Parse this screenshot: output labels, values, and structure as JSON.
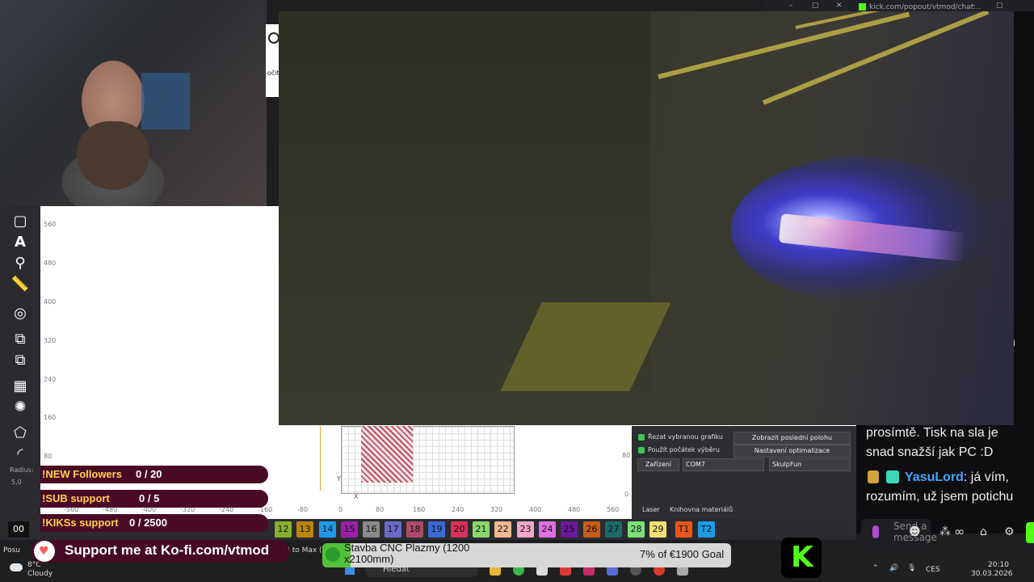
{
  "browser": {
    "url": "kick.com/popout/vtmod/chat..."
  },
  "app": {
    "y_ticks": [
      "560",
      "480",
      "400",
      "320",
      "240",
      "160",
      "80"
    ],
    "x_ticks": [
      "-560",
      "-480",
      "-400",
      "-320",
      "-240",
      "-160",
      "-80",
      "0",
      "80",
      "160",
      "240",
      "320",
      "400",
      "480",
      "560"
    ],
    "right_y": [
      "80",
      "0"
    ],
    "left_text": "očit",
    "radius_label": "Radius:",
    "radius_value": "5,0",
    "axis_y": "Y",
    "axis_x": "X",
    "panel": {
      "cut_selected": "Řezat vybranou grafiku",
      "use_selection_start": "Použít počátek výběru",
      "show_last_position": "Zobrazit poslední polohu",
      "optimization_settings": "Nastavení optimalizace",
      "devices_label": "Zařízení",
      "port_value": "COM7",
      "device_value": "SkulpFun",
      "tab_laser": "Laser",
      "tab_library": "Knihovna materiálů"
    }
  },
  "overlay": {
    "followers_label": "!NEW Followers",
    "followers_value": "0 / 20",
    "sub_label": "!SUB support",
    "sub_value": "0 / 5",
    "kiks_label": "!KIKSs support",
    "kiks_value": "0 / 2500",
    "kofi": "Support me at Ko-fi.com/vtmod",
    "goal_name": "Stavba CNC Plazmy (1200 x2100mm)",
    "goal_value": "7% of €1900 Goal",
    "goal_progress": 0.07
  },
  "layers": {
    "first": "00",
    "chips": [
      {
        "label": "12",
        "color": "#88b02a"
      },
      {
        "label": "13",
        "color": "#b8860b"
      },
      {
        "label": "14",
        "color": "#1e9be8"
      },
      {
        "label": "15",
        "color": "#9b1fa8"
      },
      {
        "label": "16",
        "color": "#8a8a8a"
      },
      {
        "label": "17",
        "color": "#6a6ac8"
      },
      {
        "label": "18",
        "color": "#b04a6a"
      },
      {
        "label": "19",
        "color": "#3a6ad8"
      },
      {
        "label": "20",
        "color": "#d8305a"
      },
      {
        "label": "21",
        "color": "#8ad86a"
      },
      {
        "label": "22",
        "color": "#f0b890"
      },
      {
        "label": "23",
        "color": "#f0a8c8"
      },
      {
        "label": "24",
        "color": "#e070e0"
      },
      {
        "label": "25",
        "color": "#6a1a9a"
      },
      {
        "label": "26",
        "color": "#c85a1a"
      },
      {
        "label": "27",
        "color": "#1a6a6a"
      },
      {
        "label": "28",
        "color": "#7ae07a"
      },
      {
        "label": "29",
        "color": "#f0e070"
      },
      {
        "label": "T1",
        "color": "#e8561a"
      },
      {
        "label": "T2",
        "color": "#1e9be8"
      }
    ]
  },
  "chat": {
    "line1": "prosímtě. Tisk na sla je",
    "line2": "snad snažší jak PC :D",
    "user": "YasuLord",
    "msg1": ": já vím,",
    "msg2": "rozumím, už jsem potichu",
    "placeholder": "Send a message",
    "side_letter": "n"
  },
  "taskbar": {
    "weather_temp": "8°C",
    "weather_desc": "Cloudy",
    "search": "Hledat",
    "lang": "CES",
    "time": "20:10",
    "date": "30.03.2026",
    "left_snippet": "Posu",
    "mid_snippet": "y) to Max (14("
  }
}
